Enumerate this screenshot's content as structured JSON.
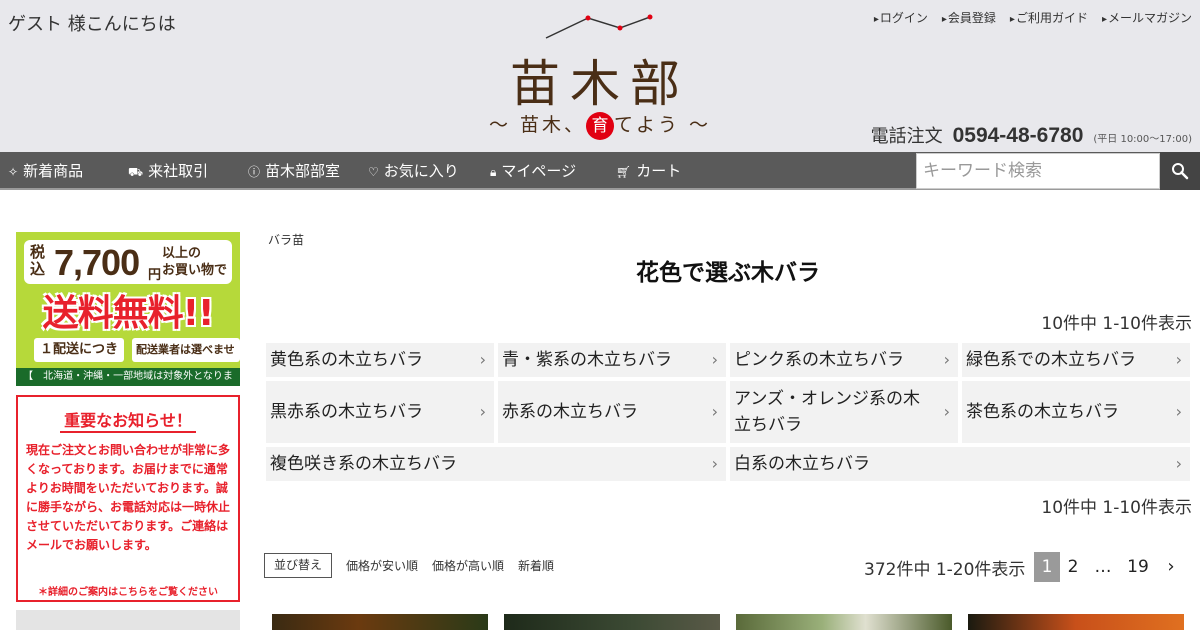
{
  "header": {
    "greeting": "ゲスト 様こんにちは",
    "top_links": [
      "ログイン",
      "会員登録",
      "ご利用ガイド",
      "メールマガジン"
    ],
    "logo": {
      "name": "苗木部",
      "tagline_before": "～ 苗木、",
      "tagline_highlight": "育",
      "tagline_after": "てよう ～"
    },
    "phone": {
      "label": "電話注文",
      "number": "0594-48-6780",
      "hours": "(平日 10:00〜17:00)"
    }
  },
  "nav": {
    "items": [
      {
        "label": "新着商品",
        "icon": "sparkle-icon"
      },
      {
        "label": "来社取引",
        "icon": "truck-icon"
      },
      {
        "label": "苗木部部室",
        "icon": "info-icon"
      },
      {
        "label": "お気に入り",
        "icon": "heart-icon"
      },
      {
        "label": "マイページ",
        "icon": "lock-icon"
      },
      {
        "label": "カート",
        "icon": "cart-icon"
      }
    ],
    "search_placeholder": "キーワード検索"
  },
  "sidebar": {
    "shipping_banner": {
      "tax_label": "税込",
      "amount": "7,700",
      "yen": "円",
      "condition_line1": "以上の",
      "condition_line2": "お買い物で",
      "free_text": "送料無料!!",
      "per_shipment": "１配送につき",
      "carrier_note": "配送業者は選べません",
      "exclusion_note": "【　北海道・沖縄・一部地域は対象外となります　】"
    },
    "notice_banner": {
      "title": "重要なお知らせ！",
      "body": "現在ご注文とお問い合わせが非常に多くなっております。お届けまでに通常よりお時間をいただいております。誠に勝手ながら、お電話対応は一時休止させていただいております。ご連絡はメールでお願いします。",
      "link": "＊詳細のご案内はこちらをご覧ください"
    }
  },
  "main": {
    "breadcrumb": "バラ苗",
    "title": "花色で選ぶ木バラ",
    "category_count": "10件中 1-10件表示",
    "categories": [
      "黄色系の木立ちバラ",
      "青・紫系の木立ちバラ",
      "ピンク系の木立ちバラ",
      "緑色系での木立ちバラ",
      "黒赤系の木立ちバラ",
      "赤系の木立ちバラ",
      "アンズ・オレンジ系の木立ちバラ",
      "茶色系の木立ちバラ",
      "複色咲き系の木立ちバラ",
      "白系の木立ちバラ"
    ],
    "sort": {
      "label": "並び替え",
      "options": [
        "価格が安い順",
        "価格が高い順",
        "新着順"
      ]
    },
    "result_count": "372件中 1-20件表示",
    "pagination": {
      "pages": [
        "1",
        "2",
        "…",
        "19"
      ],
      "current": "1",
      "next_icon": "chevron-right-icon"
    }
  },
  "colors": {
    "header_bg": "#e8e8ec",
    "nav_bg": "#5a5a5a",
    "brand_brown": "#4a2e16",
    "accent_red": "#e10012",
    "banner_green": "#b6d93a"
  }
}
